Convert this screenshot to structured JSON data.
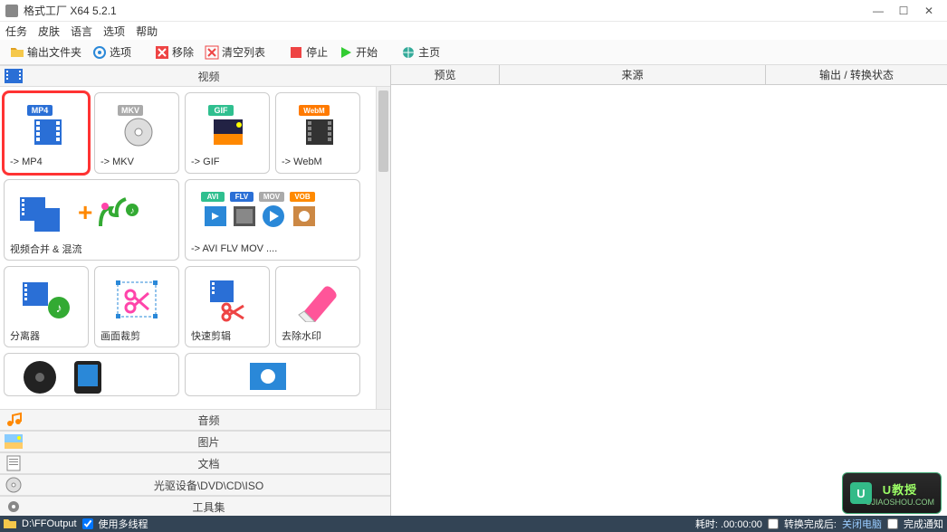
{
  "window": {
    "title": "格式工厂 X64 5.2.1"
  },
  "menu": [
    "任务",
    "皮肤",
    "语言",
    "选项",
    "帮助"
  ],
  "toolbar": [
    {
      "id": "output-folder",
      "label": "输出文件夹"
    },
    {
      "id": "options",
      "label": "选项"
    },
    {
      "id": "remove",
      "label": "移除"
    },
    {
      "id": "clear-list",
      "label": "清空列表"
    },
    {
      "id": "stop",
      "label": "停止"
    },
    {
      "id": "start",
      "label": "开始"
    },
    {
      "id": "home",
      "label": "主页"
    }
  ],
  "categories": {
    "video": "视频",
    "audio": "音频",
    "image": "图片",
    "doc": "文档",
    "disc": "光驱设备\\DVD\\CD\\ISO",
    "tools": "工具集"
  },
  "tiles": {
    "mp4": {
      "badge": "MP4",
      "badge_color": "#2a6fd6",
      "label": "-> MP4"
    },
    "mkv": {
      "badge": "MKV",
      "badge_color": "#aaaaaa",
      "label": "-> MKV"
    },
    "gif": {
      "badge": "GIF",
      "badge_color": "#2fbf8f",
      "label": "-> GIF"
    },
    "webm": {
      "badge": "WebM",
      "badge_color": "#ff7a00",
      "label": "-> WebM"
    },
    "merge": {
      "label": "视频合并 & 混流"
    },
    "multi": {
      "badges": [
        "AVI",
        "FLV",
        "MOV",
        "VOB"
      ],
      "badge_colors": [
        "#2fbf8f",
        "#2a6fd6",
        "#aaaaaa",
        "#ff8a00"
      ],
      "label": "-> AVI FLV MOV ...."
    },
    "split": {
      "label": "分离器"
    },
    "crop": {
      "label": "画面裁剪"
    },
    "quick": {
      "label": "快速剪辑"
    },
    "unwm": {
      "label": "去除水印"
    }
  },
  "right_cols": {
    "preview": "预览",
    "source": "来源",
    "status": "输出 / 转换状态"
  },
  "statusbar": {
    "output_path": "D:\\FFOutput",
    "multithread": "使用多线程",
    "elapsed": "耗时: .00:00:00",
    "after_done": "转换完成后:",
    "shutdown": "关闭电脑",
    "notify": "完成通知"
  },
  "watermark": {
    "top": "U教授",
    "bot": "UJIAOSHOU.COM"
  }
}
